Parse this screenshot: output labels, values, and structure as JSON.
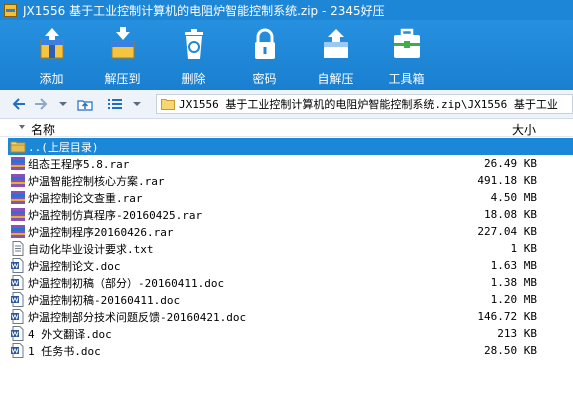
{
  "window": {
    "title": "JX1556 基于工业控制计算机的电阻炉智能控制系统.zip - 2345好压"
  },
  "toolbar": {
    "items": [
      {
        "label": "添加",
        "icon": "add-archive-icon"
      },
      {
        "label": "解压到",
        "icon": "extract-icon"
      },
      {
        "label": "删除",
        "icon": "delete-icon"
      },
      {
        "label": "密码",
        "icon": "lock-icon"
      },
      {
        "label": "自解压",
        "icon": "self-extract-icon"
      },
      {
        "label": "工具箱",
        "icon": "toolbox-icon"
      }
    ]
  },
  "path": {
    "text": "JX1556 基于工业控制计算机的电阻炉智能控制系统.zip\\JX1556 基于工业"
  },
  "columns": {
    "name": "名称",
    "size": "大小"
  },
  "files": [
    {
      "name": "..(上层目录)",
      "size": "",
      "type": "parent"
    },
    {
      "name": "组态王程序5.8.rar",
      "size": "26.49 KB",
      "type": "rar"
    },
    {
      "name": "炉温智能控制核心方案.rar",
      "size": "491.18 KB",
      "type": "rar"
    },
    {
      "name": "炉温控制论文查重.rar",
      "size": "4.50 MB",
      "type": "rar"
    },
    {
      "name": "炉温控制仿真程序-20160425.rar",
      "size": "18.08 KB",
      "type": "rar"
    },
    {
      "name": "炉温控制程序20160426.rar",
      "size": "227.04 KB",
      "type": "rar"
    },
    {
      "name": "自动化毕业设计要求.txt",
      "size": "1 KB",
      "type": "txt"
    },
    {
      "name": "炉温控制论文.doc",
      "size": "1.63 MB",
      "type": "doc"
    },
    {
      "name": "炉温控制初稿（部分）-20160411.doc",
      "size": "1.38 MB",
      "type": "doc"
    },
    {
      "name": "炉温控制初稿-20160411.doc",
      "size": "1.20 MB",
      "type": "doc"
    },
    {
      "name": "炉温控制部分技术问题反馈-20160421.doc",
      "size": "146.72 KB",
      "type": "doc"
    },
    {
      "name": "4 外文翻译.doc",
      "size": "213 KB",
      "type": "doc"
    },
    {
      "name": "1 任务书.doc",
      "size": "28.50 KB",
      "type": "doc"
    }
  ],
  "colors": {
    "accent": "#1d86d6",
    "selection": "#1a87d8"
  }
}
